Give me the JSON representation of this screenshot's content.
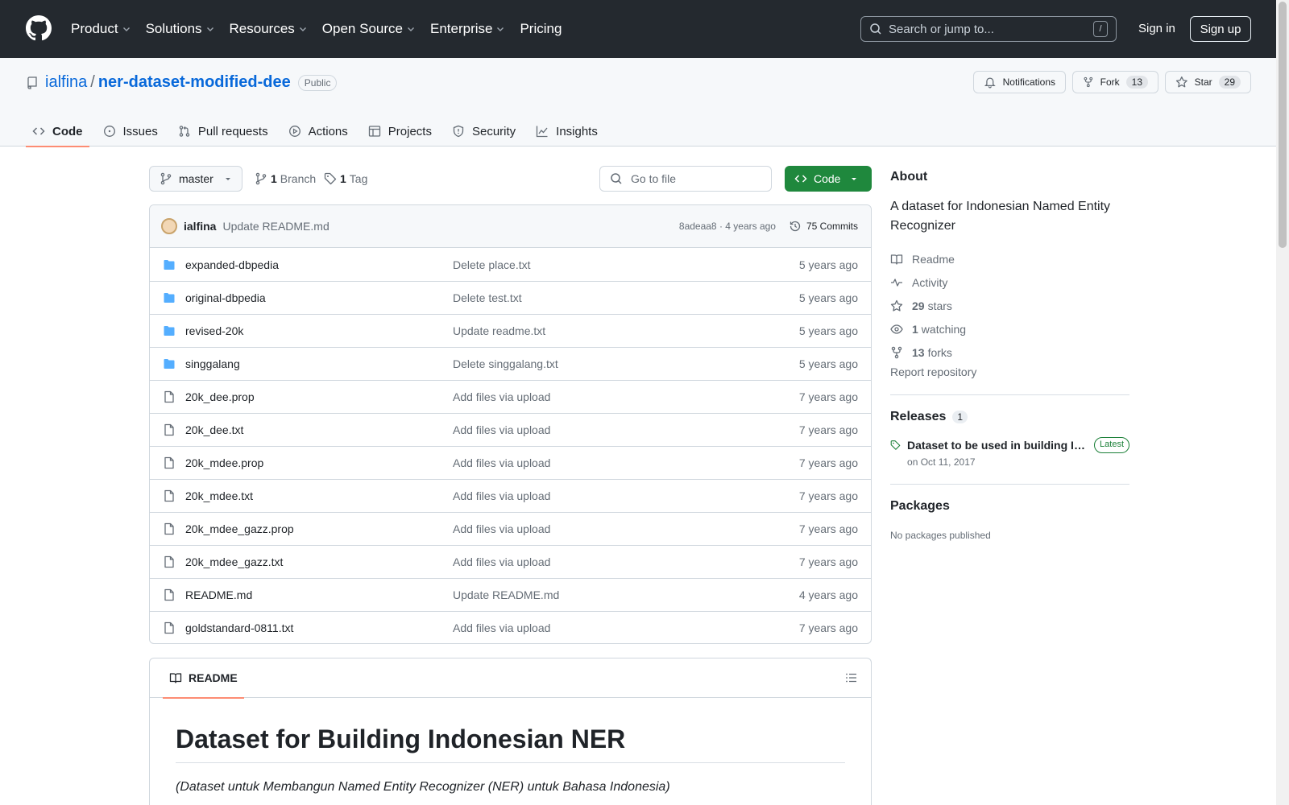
{
  "nav": {
    "items": [
      "Product",
      "Solutions",
      "Resources",
      "Open Source",
      "Enterprise",
      "Pricing"
    ],
    "search_placeholder": "Search or jump to...",
    "slash_key": "/",
    "sign_in": "Sign in",
    "sign_up": "Sign up"
  },
  "repo": {
    "owner": "ialfina",
    "separator": "/",
    "name": "ner-dataset-modified-dee",
    "visibility": "Public",
    "notifications_label": "Notifications",
    "fork_label": "Fork",
    "fork_count": "13",
    "star_label": "Star",
    "star_count": "29"
  },
  "tabs": [
    {
      "label": "Code",
      "icon": "code-icon",
      "active": true
    },
    {
      "label": "Issues",
      "icon": "issue-icon"
    },
    {
      "label": "Pull requests",
      "icon": "pull-request-icon"
    },
    {
      "label": "Actions",
      "icon": "play-icon"
    },
    {
      "label": "Projects",
      "icon": "table-icon"
    },
    {
      "label": "Security",
      "icon": "shield-icon"
    },
    {
      "label": "Insights",
      "icon": "graph-icon"
    }
  ],
  "toolbar": {
    "branch": "master",
    "branch_count": "1",
    "branch_label": "Branch",
    "tag_count": "1",
    "tag_label": "Tag",
    "go_to_file": "Go to file",
    "code_button": "Code"
  },
  "latest_commit": {
    "author": "ialfina",
    "message": "Update README.md",
    "sha_age": "8adeaa8 · 4 years ago",
    "commits": "75 Commits"
  },
  "files": [
    {
      "type": "dir",
      "name": "expanded-dbpedia",
      "message": "Delete place.txt",
      "age": "5 years ago"
    },
    {
      "type": "dir",
      "name": "original-dbpedia",
      "message": "Delete test.txt",
      "age": "5 years ago"
    },
    {
      "type": "dir",
      "name": "revised-20k",
      "message": "Update readme.txt",
      "age": "5 years ago"
    },
    {
      "type": "dir",
      "name": "singgalang",
      "message": "Delete singgalang.txt",
      "age": "5 years ago"
    },
    {
      "type": "file",
      "name": "20k_dee.prop",
      "message": "Add files via upload",
      "age": "7 years ago"
    },
    {
      "type": "file",
      "name": "20k_dee.txt",
      "message": "Add files via upload",
      "age": "7 years ago"
    },
    {
      "type": "file",
      "name": "20k_mdee.prop",
      "message": "Add files via upload",
      "age": "7 years ago"
    },
    {
      "type": "file",
      "name": "20k_mdee.txt",
      "message": "Add files via upload",
      "age": "7 years ago"
    },
    {
      "type": "file",
      "name": "20k_mdee_gazz.prop",
      "message": "Add files via upload",
      "age": "7 years ago"
    },
    {
      "type": "file",
      "name": "20k_mdee_gazz.txt",
      "message": "Add files via upload",
      "age": "7 years ago"
    },
    {
      "type": "file",
      "name": "README.md",
      "message": "Update README.md",
      "age": "4 years ago"
    },
    {
      "type": "file",
      "name": "goldstandard-0811.txt",
      "message": "Add files via upload",
      "age": "7 years ago"
    }
  ],
  "readme": {
    "tab_label": "README",
    "heading": "Dataset for Building Indonesian NER",
    "subtitle": "(Dataset untuk Membangun Named Entity Recognizer (NER) untuk Bahasa Indonesia)"
  },
  "about": {
    "title": "About",
    "description": "A dataset for Indonesian Named Entity Recognizer",
    "readme": "Readme",
    "activity": "Activity",
    "stars_count": "29",
    "stars_label": "stars",
    "watching_count": "1",
    "watching_label": "watching",
    "forks_count": "13",
    "forks_label": "forks",
    "report": "Report repository"
  },
  "releases": {
    "title": "Releases",
    "count": "1",
    "item_title": "Dataset to be used in building Indonesian NER",
    "latest_badge": "Latest",
    "date": "on Oct 11, 2017"
  },
  "packages": {
    "title": "Packages",
    "empty": "No packages published"
  },
  "colors": {
    "header_bg": "#24292f",
    "link": "#0969da",
    "code_button": "#1f883d",
    "active_tab_underline": "#fd8c73",
    "folder": "#54aeff"
  }
}
